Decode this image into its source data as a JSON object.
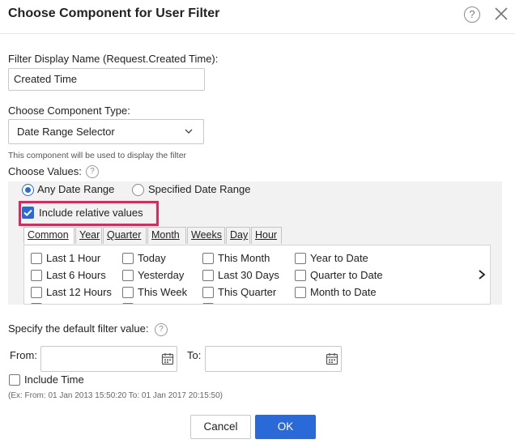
{
  "dialog": {
    "title": "Choose Component for User Filter",
    "help_glyph": "?",
    "icons": {
      "help": "help-circle-icon",
      "close": "close-icon"
    }
  },
  "display_name": {
    "label": "Filter Display Name (Request.Created Time):",
    "value": "Created Time"
  },
  "component_type": {
    "label": "Choose Component Type:",
    "selected": "Date Range Selector",
    "hint": "This component will be used to display the filter"
  },
  "choose_values": {
    "label": "Choose Values:",
    "help_glyph": "?",
    "radios": [
      {
        "label": "Any Date Range",
        "checked": true
      },
      {
        "label": "Specified Date Range",
        "checked": false
      }
    ],
    "include_relative": {
      "label": "Include relative values",
      "checked": true
    },
    "tabs": [
      "Common",
      "Year",
      "Quarter",
      "Month",
      "Weeks",
      "Day",
      "Hour"
    ],
    "active_tab": "Common",
    "options": [
      [
        "Last 1 Hour",
        "Today",
        "This Month",
        "Year to Date"
      ],
      [
        "Last 6 Hours",
        "Yesterday",
        "Last 30 Days",
        "Quarter to Date"
      ],
      [
        "Last 12 Hours",
        "This Week",
        "This Quarter",
        "Month to Date"
      ]
    ]
  },
  "default_value": {
    "label": "Specify the default filter value:",
    "help_glyph": "?",
    "from_label": "From:",
    "to_label": "To:",
    "from_value": "",
    "to_value": "",
    "include_time_label": "Include Time",
    "include_time_checked": false,
    "example": "(Ex: From: 01 Jan 2013 15:50:20 To: 01 Jan 2017 20:15:50)"
  },
  "buttons": {
    "cancel": "Cancel",
    "ok": "OK"
  },
  "colors": {
    "accent": "#2a6ad8",
    "highlight": "#e6245b",
    "panel_bg": "#f2f2f2"
  }
}
